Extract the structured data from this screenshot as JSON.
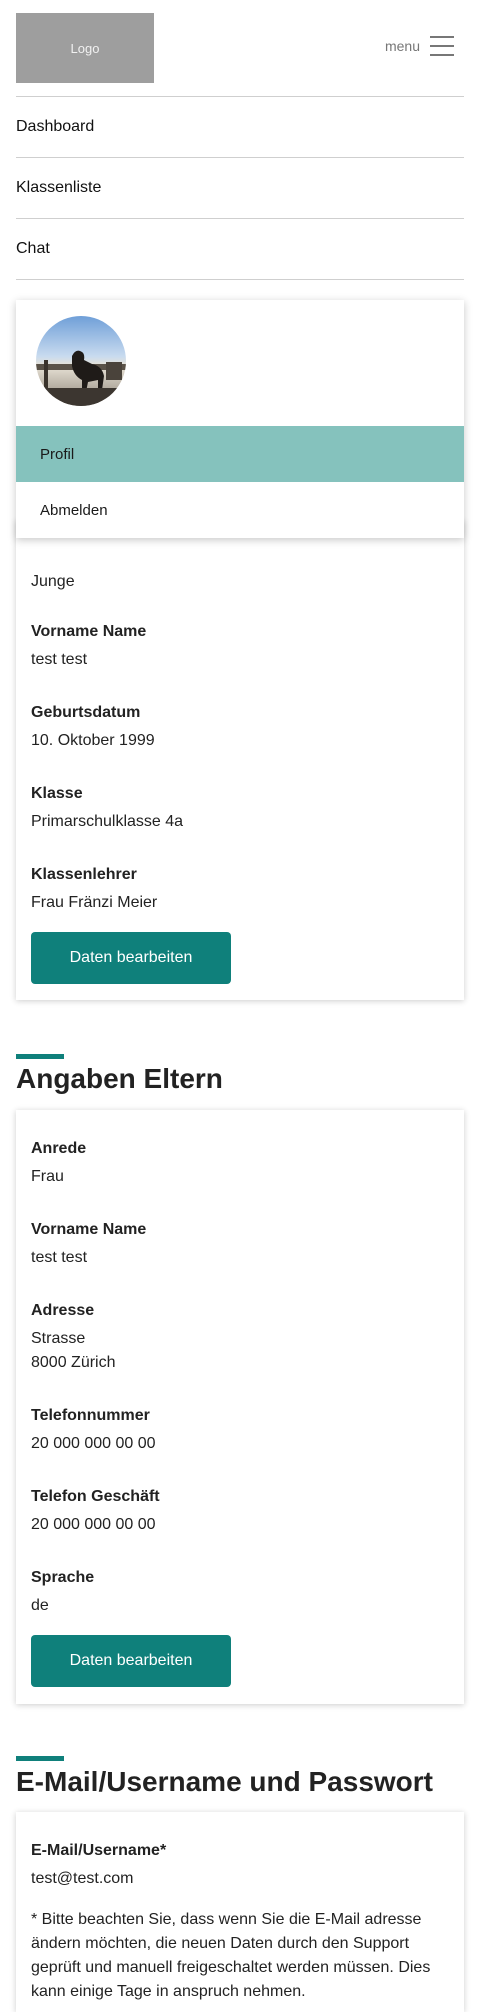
{
  "header": {
    "logo_text": "Logo",
    "menu_label": "menu"
  },
  "nav": {
    "items": [
      "Dashboard",
      "Klassenliste",
      "Chat"
    ]
  },
  "profile_menu": {
    "items": [
      "Profil",
      "Abmelden"
    ]
  },
  "child_card": {
    "top_value": "Junge",
    "fields": [
      {
        "label": "Vorname Name",
        "value": "test test"
      },
      {
        "label": "Geburtsdatum",
        "value": "10. Oktober 1999"
      },
      {
        "label": "Klasse",
        "value": "Primarschulklasse 4a"
      },
      {
        "label": "Klassenlehrer",
        "value": "Frau Fränzi Meier"
      }
    ],
    "button_label": "Daten bearbeiten"
  },
  "parents": {
    "title": "Angaben Eltern",
    "fields": [
      {
        "label": "Anrede",
        "value": "Frau"
      },
      {
        "label": "Vorname Name",
        "value": "test test"
      },
      {
        "label": "Adresse",
        "value": "Strasse",
        "value2": "8000 Zürich"
      },
      {
        "label": "Telefonnummer",
        "value": "20 000 000 00 00"
      },
      {
        "label": "Telefon Geschäft",
        "value": "20 000 000 00 00"
      },
      {
        "label": "Sprache",
        "value": "de"
      }
    ],
    "button_label": "Daten bearbeiten"
  },
  "account": {
    "title": "E-Mail/Username und Passwort",
    "email_label": "E-Mail/Username*",
    "email_value": "test@test.com",
    "note_lines": [
      "* Bitte beachten Sie, dass wenn Sie die E-Mail adresse",
      "ändern möchten, die neuen Daten durch den Support",
      "geprüft und manuell freigeschaltet werden müssen. Dies",
      "kann einige Tage in anspruch nehmen."
    ]
  },
  "colors": {
    "accent": "#0f807b",
    "active_menu": "#85c2bd",
    "logo_bg": "#9e9e9e"
  }
}
